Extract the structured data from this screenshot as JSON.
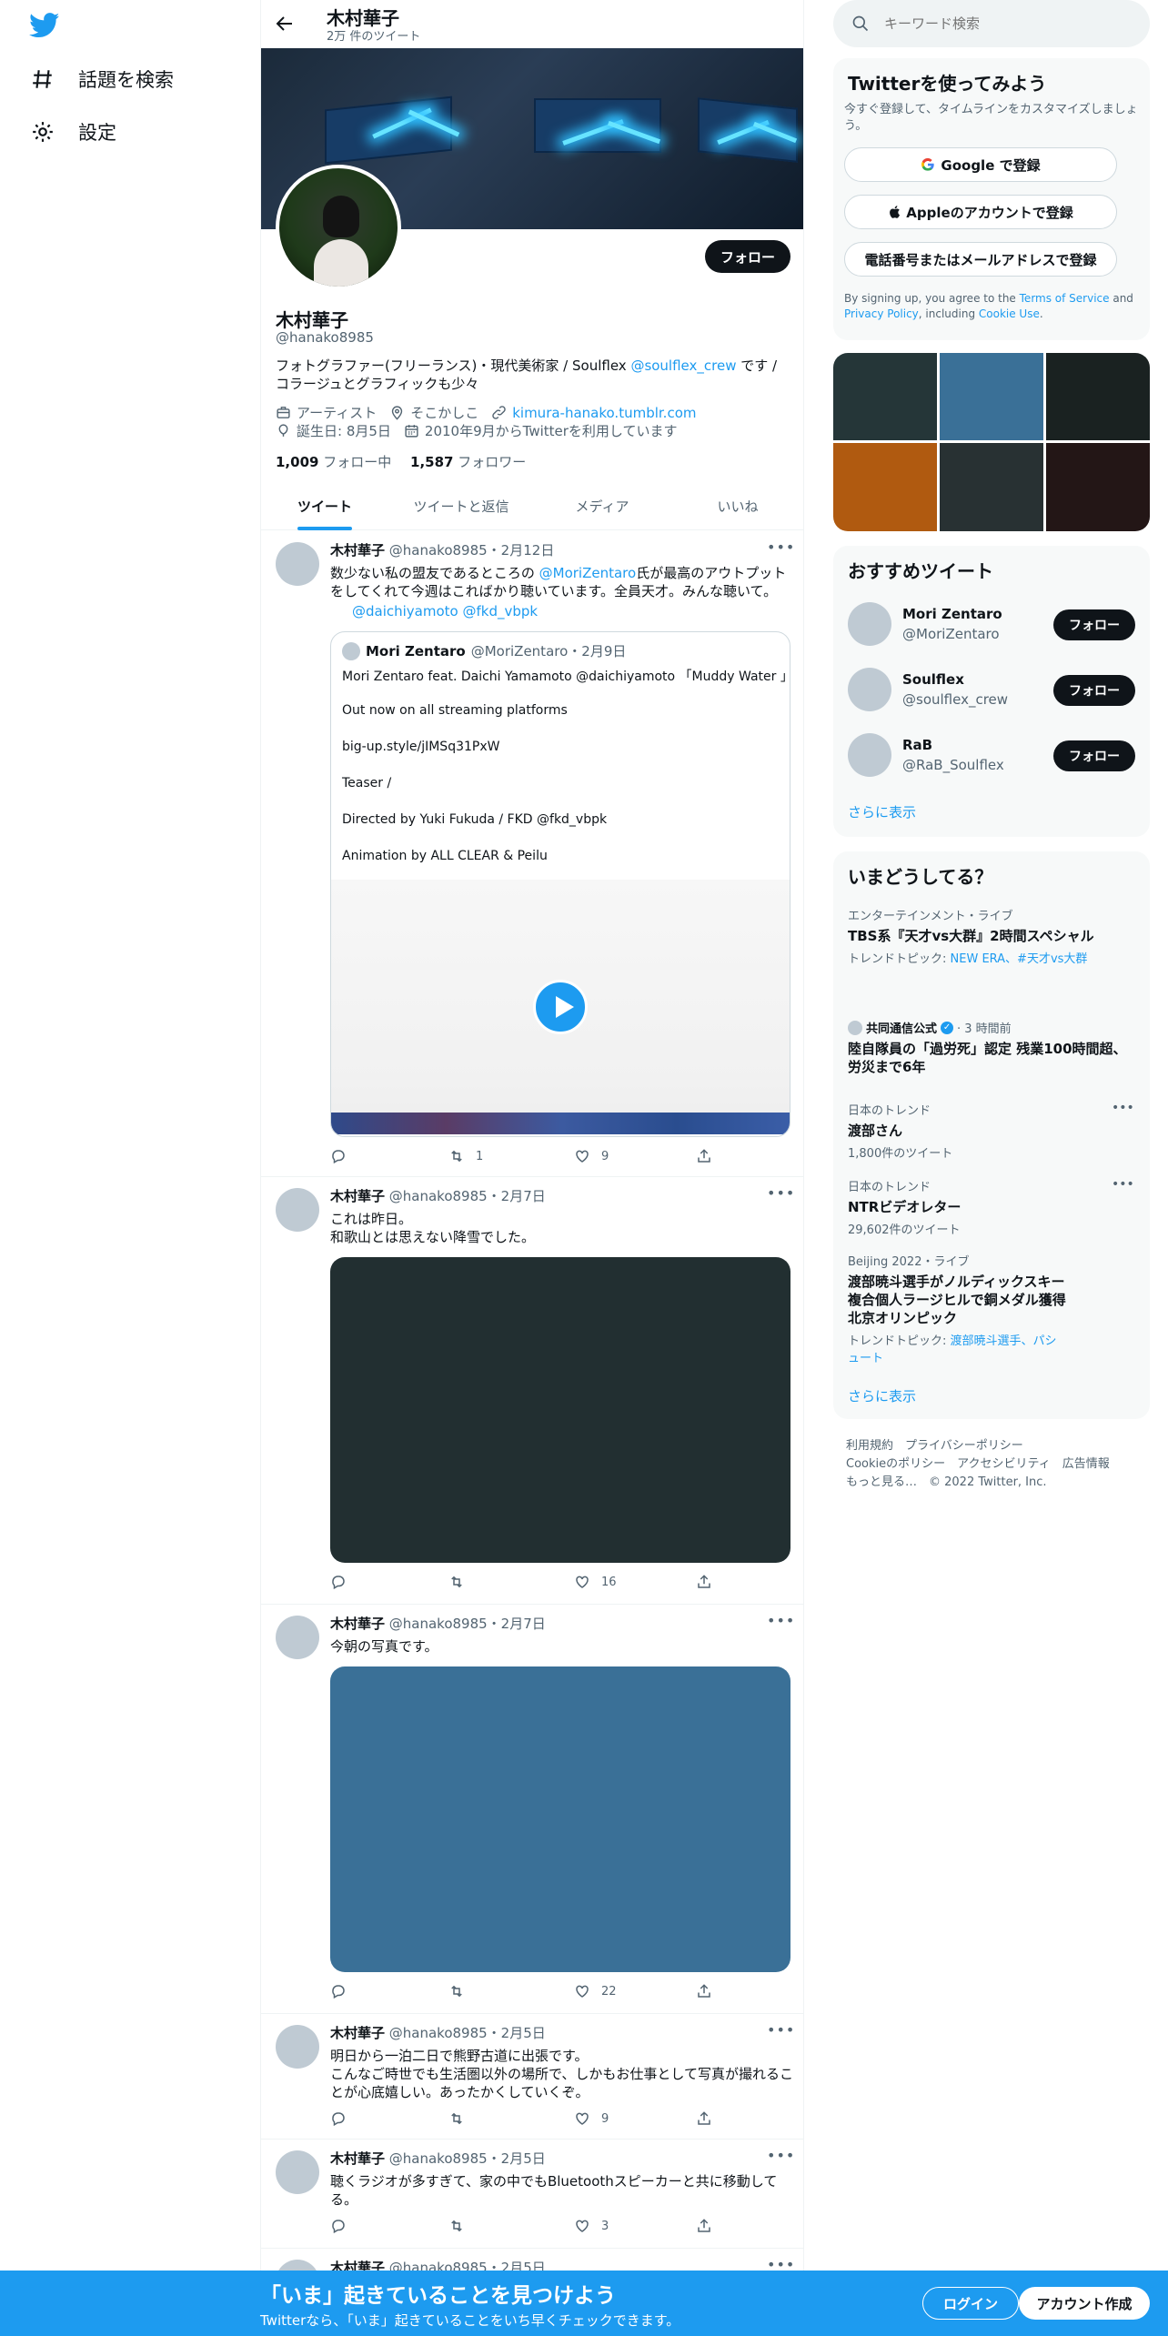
{
  "nav": {
    "explore_label": "話題を検索",
    "settings_label": "設定"
  },
  "header": {
    "name": "木村華子",
    "tweet_count": "2万 件のツイート"
  },
  "profile": {
    "follow_label": "フォロー",
    "name": "木村華子",
    "handle": "@hanako8985",
    "bio_text1": "フォトグラファー(フリーランス)・現代美術家 /  Soulflex ",
    "bio_link": "@soulflex_crew",
    "bio_text2": " です / コラージュとグラフィックも少々",
    "category": "アーティスト",
    "location": "そこかしこ",
    "website": "kimura-hanako.tumblr.com",
    "birthday": "誕生日: 8月5日",
    "joined": "2010年9月からTwitterを利用しています",
    "following_count": "1,009",
    "following_label": " フォロー中",
    "followers_count": "1,587",
    "followers_label": " フォロワー"
  },
  "tabs": [
    "ツイート",
    "ツイートと返信",
    "メディア",
    "いいね"
  ],
  "tweets": [
    {
      "name": "木村華子",
      "meta": " @hanako8985・2月12日",
      "text_a": "数少ない私の盟友であるところの ",
      "text_link": "@MoriZentaro",
      "text_b": "氏が最高のアウトプットをしてくれて今週はこればかり聴いています。全員天才。みんな聴いて。",
      "mentions": "@daichiyamoto @fkd_vbpk",
      "quote": {
        "name": "Mori Zentaro",
        "meta": " @MoriZentaro・2月9日",
        "lines": [
          "Mori Zentaro feat. Daichi Yamamoto @daichiyamoto 「Muddy Water 」",
          "Out now on all streaming platforms",
          "big-up.style/jIMSq31PxW",
          "Teaser /",
          "Directed by Yuki Fukuda / FKD @fkd_vbpk",
          "Animation by ALL CLEAR & Peilu"
        ]
      },
      "retweets": "1",
      "likes": "9"
    },
    {
      "name": "木村華子",
      "meta": " @hanako8985・2月7日",
      "text": "これは昨日。\n和歌山とは思えない降雪でした。",
      "media_color": "#222f31",
      "likes": "16"
    },
    {
      "name": "木村華子",
      "meta": " @hanako8985・2月7日",
      "text": "今朝の写真です。",
      "media_color": "#3a7097",
      "likes": "22"
    },
    {
      "name": "木村華子",
      "meta": " @hanako8985・2月5日",
      "text": "明日から一泊二日で熊野古道に出張です。\nこんなご時世でも生活圏以外の場所で、しかもお仕事として写真が撮れることが心底嬉しい。あったかくしていくぞ。",
      "likes": "9"
    },
    {
      "name": "木村華子",
      "meta": " @hanako8985・2月5日",
      "text": "聴くラジオが多すぎて、家の中でもBluetoothスピーカーと共に移動してる。",
      "likes": "3"
    },
    {
      "name": "木村華子",
      "meta": " @hanako8985・2月5日"
    }
  ],
  "search": {
    "placeholder": "キーワード検索"
  },
  "signup": {
    "title": "Twitterを使ってみよう",
    "subtitle": "今すぐ登録して、タイムラインをカスタマイズしましょう。",
    "google": "Google で登録",
    "apple": "Appleのアカウントで登録",
    "phone": "電話番号またはメールアドレスで登録",
    "terms_a": "By signing up, you agree to the ",
    "terms_link1": "Terms of Service",
    "terms_b": " and ",
    "terms_link2": "Privacy Policy",
    "terms_c": ", including ",
    "terms_link3": "Cookie Use",
    "terms_d": "."
  },
  "media_grid_colors": [
    "#253638",
    "#3a7097",
    "#1a2221",
    "#b05a10",
    "#283133",
    "#231616"
  ],
  "who_to_follow": {
    "title": "おすすめツイート",
    "users": [
      {
        "name": "Mori Zentaro",
        "handle": "@MoriZentaro",
        "button": "フォロー"
      },
      {
        "name": "Soulflex",
        "handle": "@soulflex_crew",
        "button": "フォロー"
      },
      {
        "name": "RaB",
        "handle": "@RaB_Soulflex",
        "button": "フォロー"
      }
    ],
    "more": "さらに表示"
  },
  "trends": {
    "title": "いまどうしてる？",
    "items": [
      {
        "context": "エンターテインメント・ライブ",
        "title": "TBS系『天才vs大群』2時間スペシャル",
        "sub_a": "トレンドトピック: ",
        "sub_link": "NEW ERA、#天才vs大群"
      },
      {
        "context_name": "共同通信公式",
        "context_time": " · 3 時間前",
        "title": "陸自隊員の「過労死」認定 残業100時間超、労災まで6年"
      },
      {
        "context": "日本のトレンド",
        "title": "渡部さん",
        "sub": "1,800件のツイート"
      },
      {
        "context": "日本のトレンド",
        "title": "NTRビデオレター",
        "sub": "29,602件のツイート"
      },
      {
        "context": "Beijing 2022・ライブ",
        "title": "渡部暁斗選手がノルディックスキー複合個人ラージヒルで銅メダル獲得　北京オリンピック",
        "sub_a": "トレンドトピック: ",
        "sub_link": "渡部暁斗選手、パシュート"
      }
    ],
    "more": "さらに表示"
  },
  "footer": {
    "line1": "利用規約　プライバシーポリシー",
    "line2": "Cookieのポリシー　アクセシビリティ　広告情報",
    "line3": "もっと見る…　© 2022 Twitter, Inc."
  },
  "bottom": {
    "headline": "「いま」起きていることを見つけよう",
    "sub": "Twitterなら、「いま」起きていることをいち早くチェックできます。",
    "login": "ログイン",
    "signup": "アカウント作成"
  }
}
